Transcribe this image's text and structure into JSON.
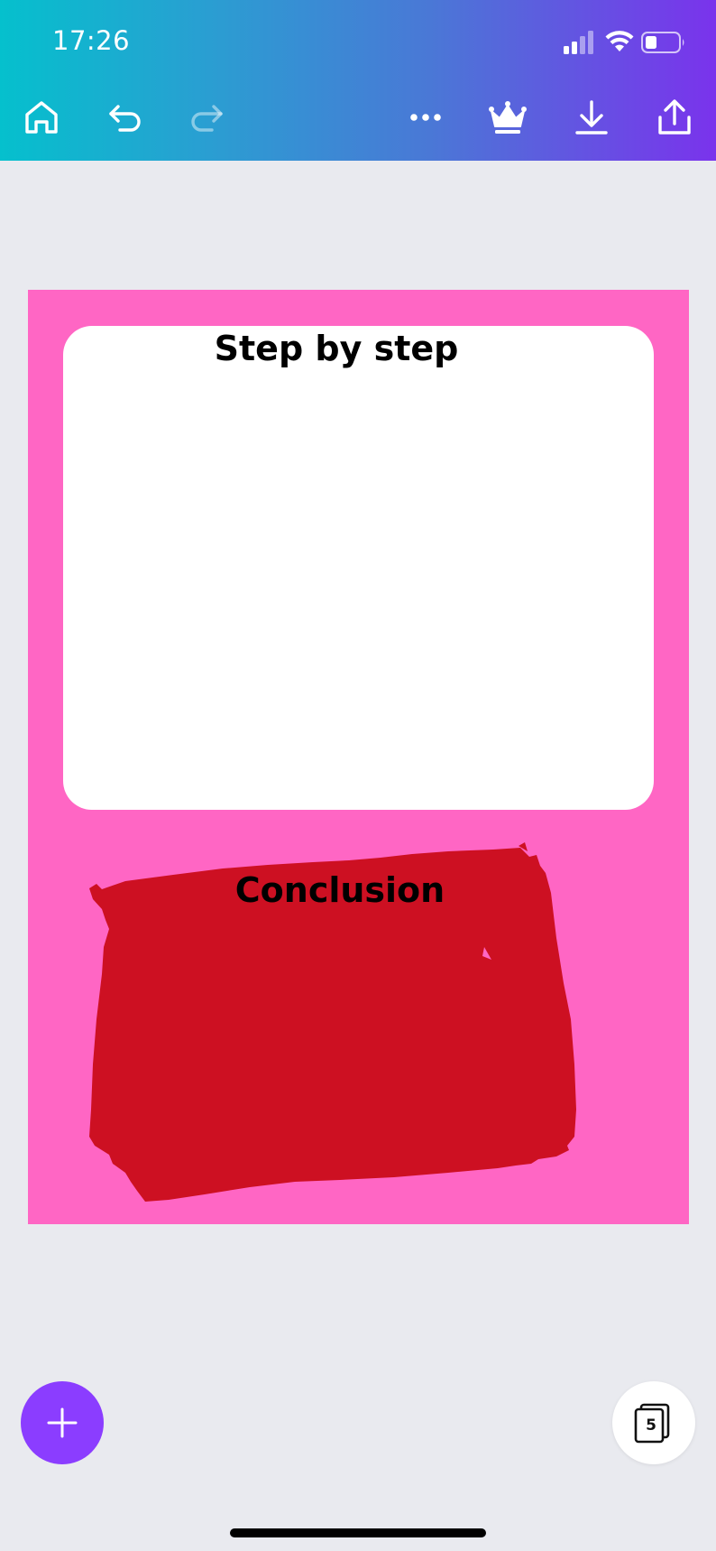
{
  "status_bar": {
    "time": "17:26"
  },
  "toolbar": {
    "icons": [
      "home-icon",
      "undo-icon",
      "redo-icon",
      "more-icon",
      "crown-icon",
      "download-icon",
      "share-icon"
    ]
  },
  "canvas": {
    "background_color": "#ff66c4",
    "section1_title": "Step by step",
    "section2_title": "Conclusion",
    "blob_color": "#cd1022"
  },
  "page_counter": {
    "count": "5"
  },
  "colors": {
    "header_gradient_start": "#05c0cd",
    "header_gradient_end": "#7a33ec",
    "fab": "#8b3dff"
  }
}
